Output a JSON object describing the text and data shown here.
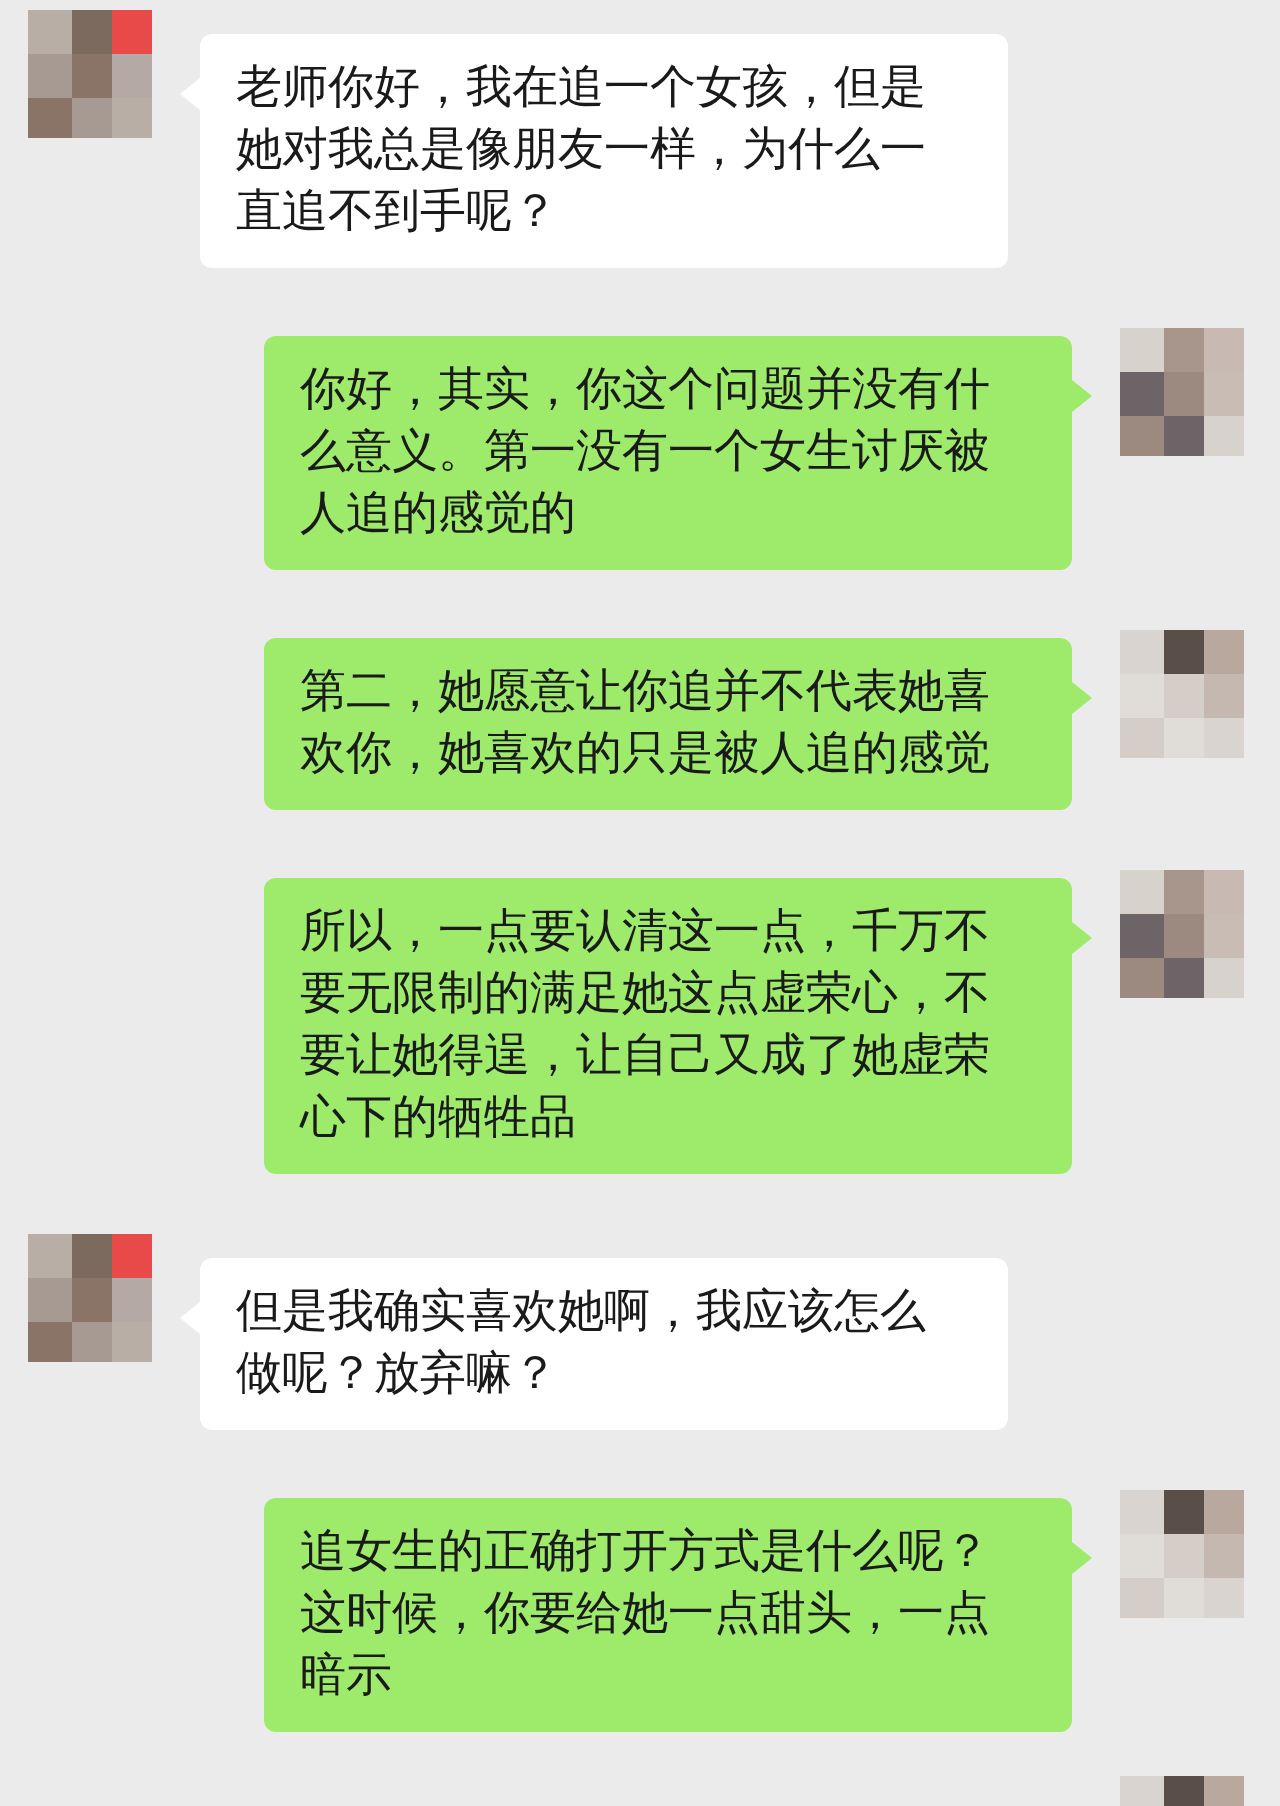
{
  "messages": [
    {
      "kind": "incoming",
      "text": "老师你好，我在追一个女孩，但是她对我总是像朋友一样，为什么一直追不到手呢？"
    },
    {
      "kind": "outgoing",
      "text": "你好，其实，你这个问题并没有什么意义。第一没有一个女生讨厌被人追的感觉的"
    },
    {
      "kind": "outgoing",
      "text": "第二，她愿意让你追并不代表她喜欢你，她喜欢的只是被人追的感觉"
    },
    {
      "kind": "outgoing",
      "text": "所以，一点要认清这一点，千万不要无限制的满足她这点虚荣心，不要让她得逞，让自己又成了她虚荣心下的牺牲品"
    },
    {
      "kind": "incoming",
      "text": "但是我确实喜欢她啊，我应该怎么做呢？放弃嘛？"
    },
    {
      "kind": "outgoing",
      "text": "追女生的正确打开方式是什么呢？这时候，你要给她一点甜头，一点暗示"
    }
  ]
}
